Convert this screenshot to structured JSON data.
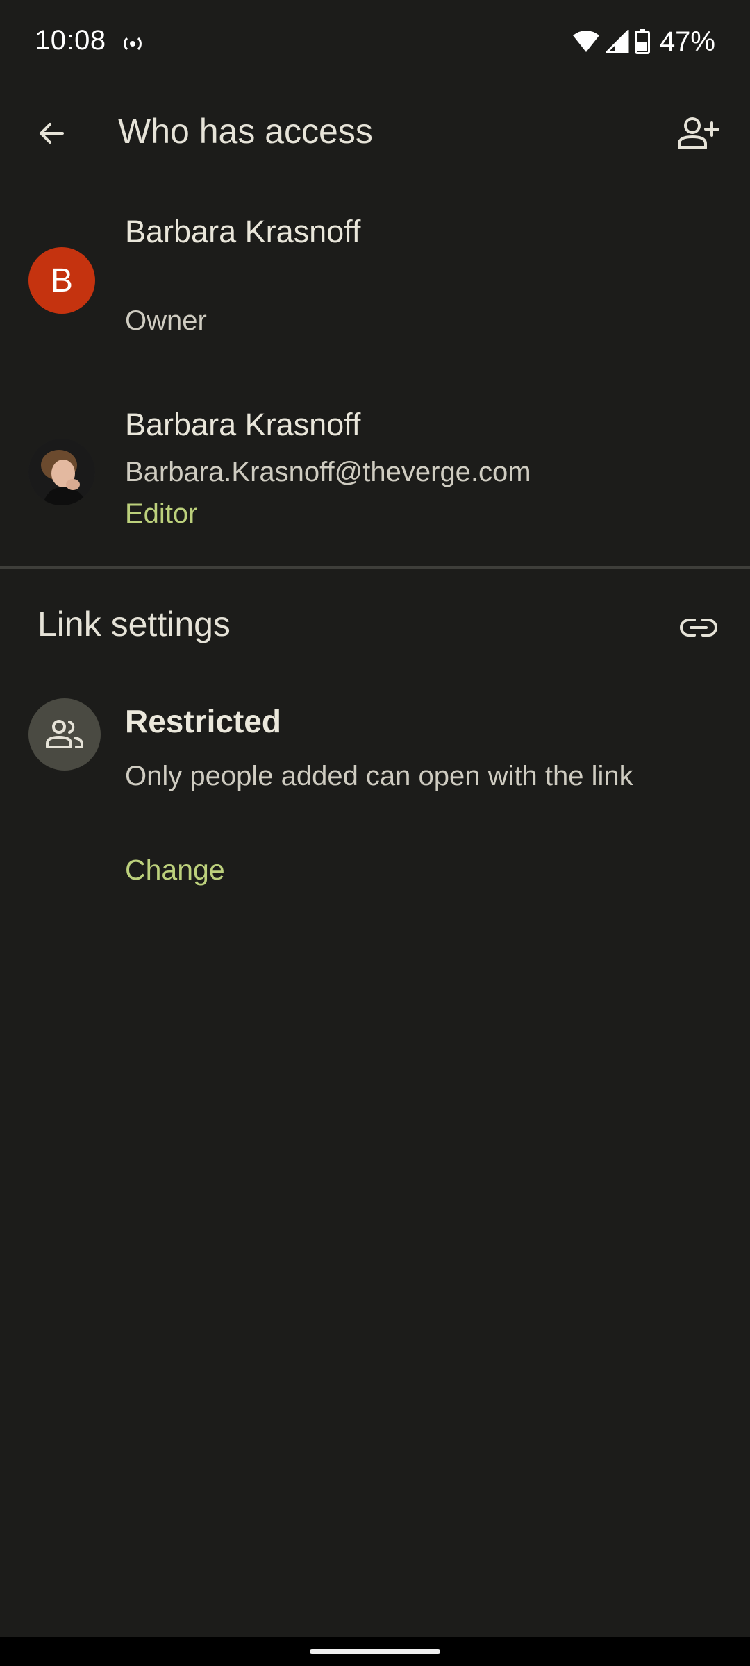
{
  "status_bar": {
    "time": "10:08",
    "battery_percent": "47%",
    "icons": [
      "hotspot-icon",
      "wifi-icon",
      "cellular-signal-icon",
      "battery-icon"
    ]
  },
  "app_bar": {
    "title": "Who has access",
    "back_icon": "arrow-back-icon",
    "add_person_icon": "person-add-icon"
  },
  "people": [
    {
      "name": "Barbara Krasnoff",
      "email": "",
      "role": "Owner",
      "avatar_type": "letter",
      "avatar_letter": "B",
      "avatar_color": "#c5330f"
    },
    {
      "name": "Barbara Krasnoff",
      "email": "Barbara.Krasnoff@theverge.com",
      "role": "Editor",
      "avatar_type": "photo",
      "role_color": "#bcd07c"
    }
  ],
  "link_settings": {
    "title": "Link settings",
    "link_icon": "link-icon",
    "access_level_icon": "people-icon",
    "access_level": "Restricted",
    "description": "Only people added can open with the link",
    "change_label": "Change"
  },
  "colors": {
    "background": "#1c1c1a",
    "accent": "#bcd07c",
    "text_primary": "#e6e3d8",
    "text_secondary": "#cfccc1"
  }
}
